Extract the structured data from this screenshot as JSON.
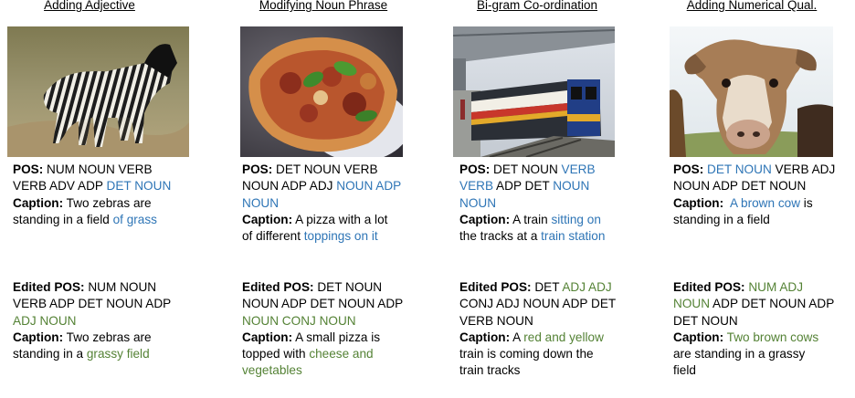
{
  "colors": {
    "highlight_blue": "#2e75b6",
    "highlight_green": "#548235"
  },
  "labels": {
    "pos": "POS:",
    "caption": "Caption:",
    "edited_pos": "Edited POS:"
  },
  "columns": [
    {
      "heading": "Adding Adjective",
      "image": "zebras-photo",
      "pos": [
        {
          "t": "NUM NOUN VERB"
        },
        {
          "t": "VERB ADV ADP "
        },
        {
          "t": "DET NOUN",
          "c": "blue"
        }
      ],
      "caption": [
        {
          "t": "Two zebras are"
        },
        {
          "t": "standing in a field "
        },
        {
          "t": "of grass",
          "c": "blue"
        }
      ],
      "edited_pos": [
        {
          "t": "NUM NOUN"
        },
        {
          "t": "VERB ADP DET NOUN ADP"
        },
        {
          "t": "ADJ NOUN",
          "c": "green"
        }
      ],
      "edited_caption": [
        {
          "t": "Two zebras are"
        },
        {
          "t": "standing in a "
        },
        {
          "t": "grassy field",
          "c": "green"
        }
      ]
    },
    {
      "heading": "Modifying Noun Phrase",
      "image": "pizza-photo",
      "pos": [
        {
          "t": "DET NOUN VERB"
        },
        {
          "t": "NOUN ADP ADJ "
        },
        {
          "t": "NOUN ADP",
          "c": "blue"
        },
        {
          "t": "NOUN",
          "c": "blue"
        }
      ],
      "caption": [
        {
          "t": "A pizza with a lot"
        },
        {
          "t": "of different "
        },
        {
          "t": "toppings on it",
          "c": "blue"
        }
      ],
      "edited_pos": [
        {
          "t": "DET NOUN"
        },
        {
          "t": "NOUN ADP DET NOUN ADP"
        },
        {
          "t": "NOUN CONJ NOUN",
          "c": "green"
        }
      ],
      "edited_caption": [
        {
          "t": "A small pizza is"
        },
        {
          "t": "topped with "
        },
        {
          "t": "cheese and",
          "c": "green"
        },
        {
          "t": "vegetables",
          "c": "green"
        }
      ]
    },
    {
      "heading": "Bi-gram Co-ordination",
      "image": "train-photo",
      "pos": [
        {
          "t": "DET NOUN "
        },
        {
          "t": "VERB",
          "c": "blue"
        },
        {
          "t": "VERB",
          "c": "blue"
        },
        {
          "t": " ADP DET "
        },
        {
          "t": "NOUN",
          "c": "blue"
        },
        {
          "t": "NOUN",
          "c": "blue"
        }
      ],
      "caption": [
        {
          "t": "A train "
        },
        {
          "t": "sitting on",
          "c": "blue"
        },
        {
          "t": "the tracks at a "
        },
        {
          "t": "train station",
          "c": "blue"
        }
      ],
      "edited_pos": [
        {
          "t": "DET "
        },
        {
          "t": "ADJ ADJ",
          "c": "green"
        },
        {
          "t": "CONJ ADJ NOUN ADP DET"
        },
        {
          "t": "VERB NOUN"
        }
      ],
      "edited_caption": [
        {
          "t": "A "
        },
        {
          "t": "red and yellow",
          "c": "green"
        },
        {
          "t": "train is coming down the"
        },
        {
          "t": "train tracks"
        }
      ]
    },
    {
      "heading": "Adding Numerical Qual.",
      "image": "cow-photo",
      "pos": [
        {
          "t": "DET NOUN",
          "c": "blue"
        },
        {
          "t": " VERB ADJ"
        },
        {
          "t": "NOUN ADP DET NOUN"
        }
      ],
      "caption": [
        {
          "t": "A brown cow",
          "c": "blue"
        },
        {
          "t": " is"
        },
        {
          "t": "standing in a field"
        }
      ],
      "edited_pos": [
        {
          "t": "NUM ADJ",
          "c": "green"
        },
        {
          "t": "NOUN",
          "c": "green"
        },
        {
          "t": " ADP DET NOUN ADP"
        },
        {
          "t": "DET NOUN"
        }
      ],
      "edited_caption": [
        {
          "t": "Two brown cows",
          "c": "green"
        },
        {
          "t": "are standing in a grassy"
        },
        {
          "t": "field"
        }
      ]
    }
  ]
}
